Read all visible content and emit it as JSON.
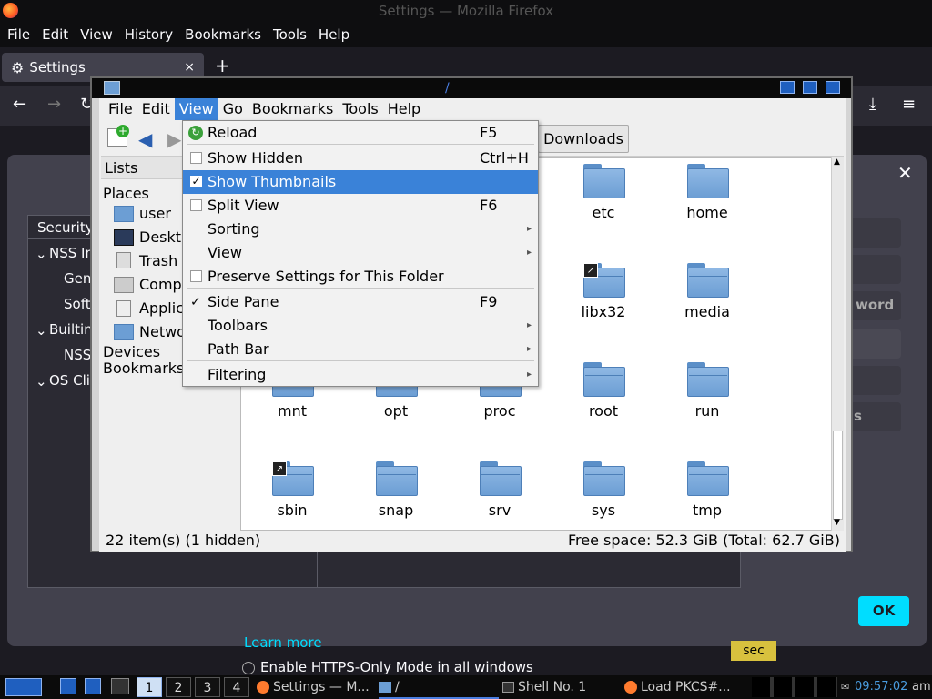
{
  "firefox": {
    "window_title": "Settings — Mozilla Firefox",
    "menu": [
      "File",
      "Edit",
      "View",
      "History",
      "Bookmarks",
      "Tools",
      "Help"
    ],
    "tab_title": "Settings",
    "tab_close": "×",
    "new_tab": "+"
  },
  "settings": {
    "device_header": "Security",
    "device_items": [
      "NSS In",
      "Gen",
      "Soft",
      "Builtin",
      "NSS",
      "OS Cli"
    ],
    "right_buttons": [
      "word",
      "s"
    ],
    "ok_label": "OK",
    "learn_more": "Learn more",
    "https_only": "Enable HTTPS-Only Mode in all windows",
    "tooltip": "sec"
  },
  "filemanager": {
    "title_path": "/",
    "menu": [
      "File",
      "Edit",
      "View",
      "Go",
      "Bookmarks",
      "Tools",
      "Help"
    ],
    "active_menu": "View",
    "toolbar_location": "Downloads",
    "side": {
      "lists": "Lists",
      "places": "Places",
      "items": [
        "user",
        "Desktop",
        "Trash",
        "Computer",
        "Applications",
        "Network"
      ],
      "devices": "Devices",
      "bookmarks": "Bookmarks"
    },
    "folders": [
      {
        "name": "etc",
        "link": false
      },
      {
        "name": "home",
        "link": false
      },
      {
        "name": "libx32",
        "link": true
      },
      {
        "name": "media",
        "link": false
      },
      {
        "name": "mnt",
        "link": false
      },
      {
        "name": "opt",
        "link": false
      },
      {
        "name": "proc",
        "link": false
      },
      {
        "name": "root",
        "link": false
      },
      {
        "name": "run",
        "link": false
      },
      {
        "name": "sbin",
        "link": true
      },
      {
        "name": "snap",
        "link": false
      },
      {
        "name": "srv",
        "link": false
      },
      {
        "name": "sys",
        "link": false
      },
      {
        "name": "tmp",
        "link": false
      }
    ],
    "status_left": "22 item(s) (1 hidden)",
    "status_right": "Free space: 52.3 GiB (Total: 62.7 GiB)"
  },
  "view_menu": {
    "items": [
      {
        "label": "Reload",
        "shortcut": "F5",
        "type": "icon"
      },
      {
        "label": "Show Hidden",
        "shortcut": "Ctrl+H",
        "type": "check",
        "checked": false
      },
      {
        "label": "Show Thumbnails",
        "shortcut": "",
        "type": "check",
        "checked": true,
        "highlighted": true
      },
      {
        "label": "Split View",
        "shortcut": "F6",
        "type": "check",
        "checked": false
      },
      {
        "label": "Sorting",
        "shortcut": "",
        "type": "submenu"
      },
      {
        "label": "View",
        "shortcut": "",
        "type": "submenu"
      },
      {
        "label": "Preserve Settings for This Folder",
        "shortcut": "",
        "type": "check",
        "checked": false
      },
      {
        "label": "Side Pane",
        "shortcut": "F9",
        "type": "tick",
        "checked": true
      },
      {
        "label": "Toolbars",
        "shortcut": "",
        "type": "submenu"
      },
      {
        "label": "Path Bar",
        "shortcut": "",
        "type": "submenu"
      },
      {
        "label": "Filtering",
        "shortcut": "",
        "type": "submenu"
      }
    ]
  },
  "taskbar": {
    "workspaces": [
      "1",
      "2",
      "3",
      "4"
    ],
    "tasks": [
      "Settings — M...",
      "/",
      "Shell No. 1",
      "Load PKCS#..."
    ],
    "clock": "09:57:02",
    "ampm": "am"
  },
  "colors": {
    "accent": "#3a82d8",
    "ff_accent": "#00ddff",
    "folder": "#6c9ed4"
  }
}
